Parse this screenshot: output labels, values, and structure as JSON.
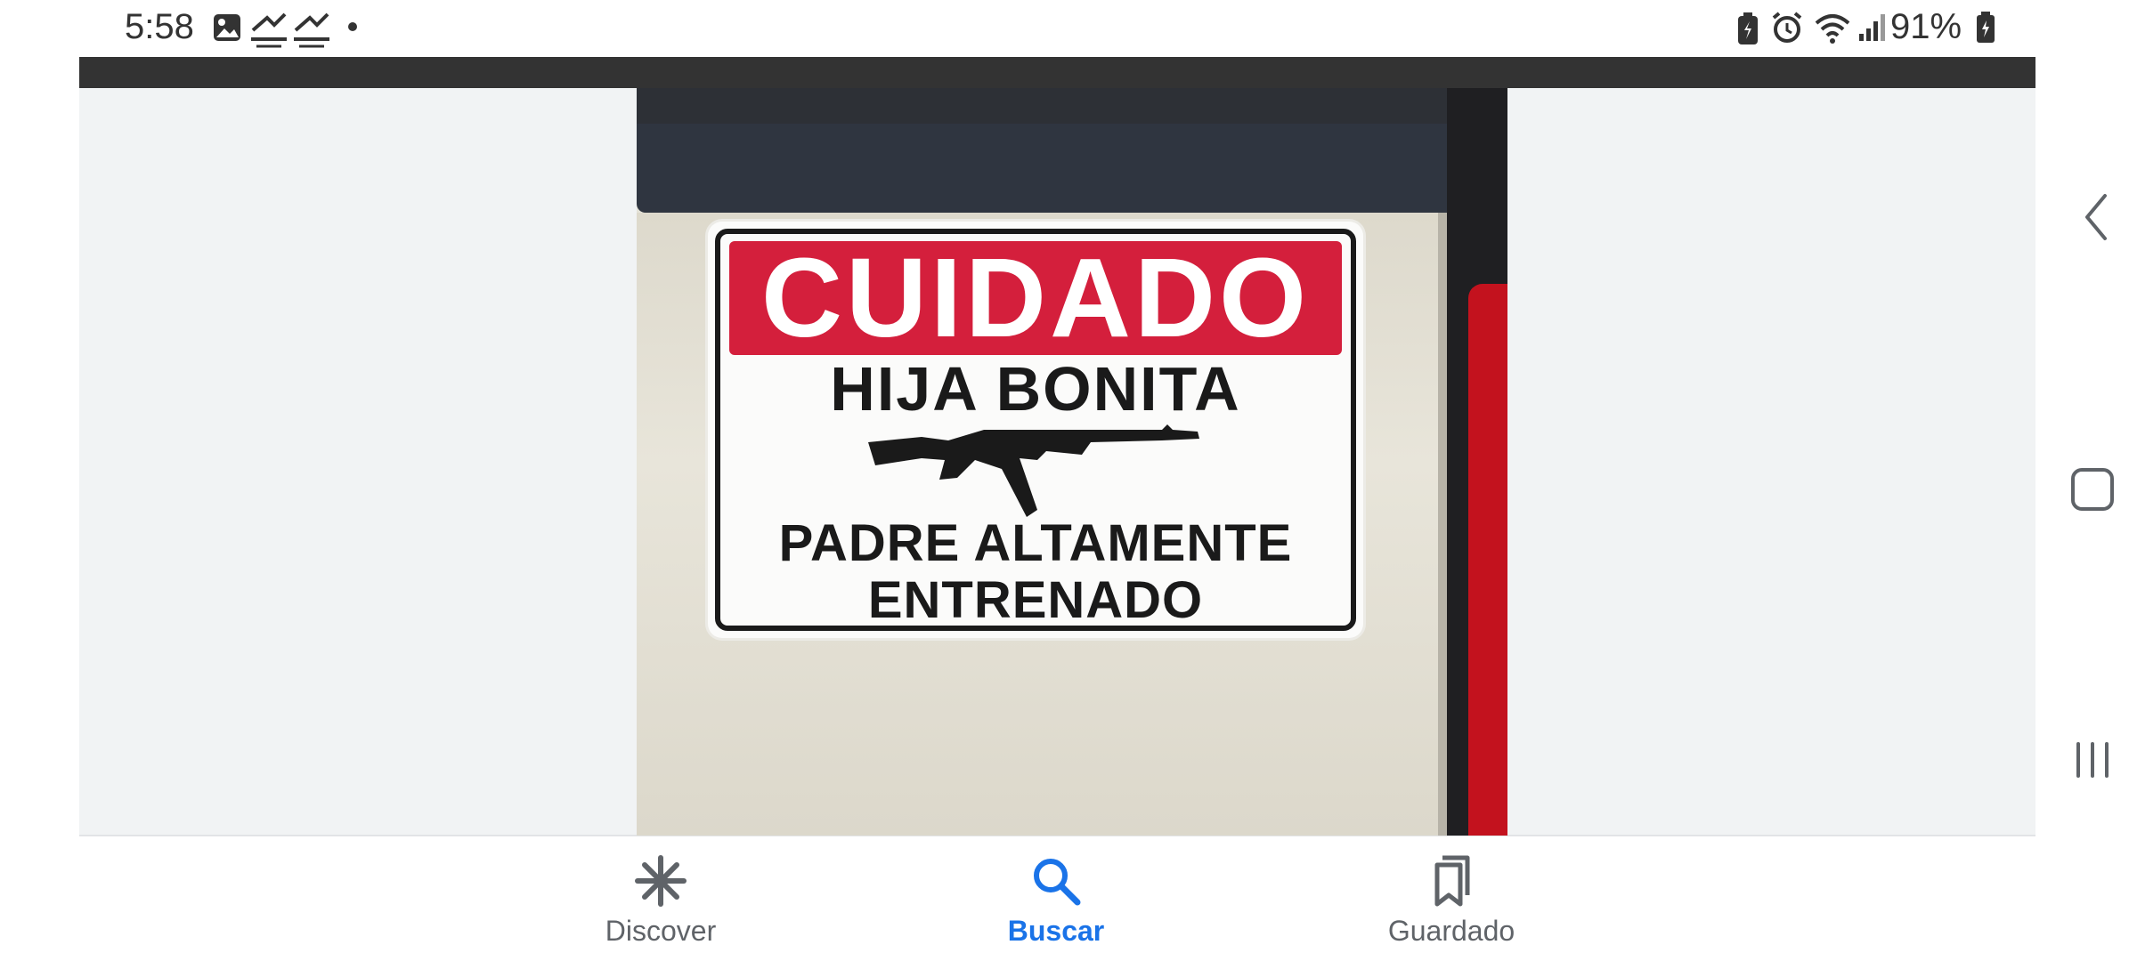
{
  "status_bar": {
    "time": "5:58",
    "left_icons": [
      "gallery-icon",
      "missed-call-icon",
      "missed-call-icon",
      "dot-icon"
    ],
    "right_icons": [
      "battery-saver-icon",
      "alarm-icon",
      "wifi-icon",
      "signal-icon"
    ],
    "battery_percent": "91%"
  },
  "image": {
    "sign": {
      "title": "CUIDADO",
      "line1": "HIJA BONITA",
      "line2": "PADRE ALTAMENTE",
      "line3": "ENTRENADO"
    }
  },
  "bottom_nav": {
    "items": [
      {
        "label": "Discover",
        "icon": "discover-icon",
        "active": false
      },
      {
        "label": "Buscar",
        "icon": "search-icon",
        "active": true
      },
      {
        "label": "Guardado",
        "icon": "saved-icon",
        "active": false
      }
    ]
  },
  "system_nav": {
    "buttons": [
      "back-icon",
      "home-icon",
      "recents-icon"
    ]
  },
  "colors": {
    "accent": "#1a73e8",
    "sign_red": "#d41f3c",
    "viewer_bg": "#f1f3f4",
    "top_strip": "#333333"
  }
}
